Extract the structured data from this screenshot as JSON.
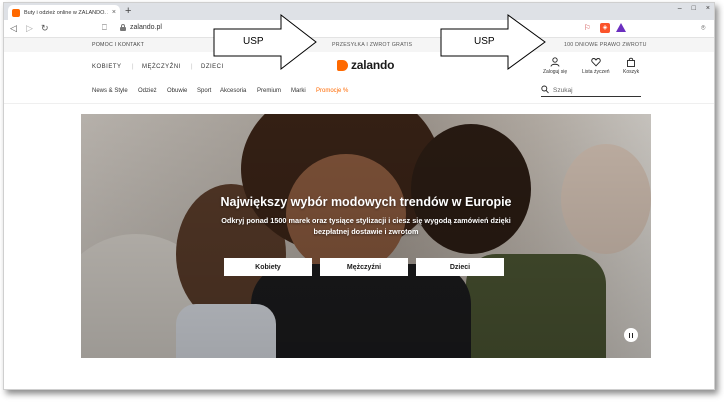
{
  "browser": {
    "tab_title": "Buty i odzież online w ZALANDO. Z",
    "tab_close": "×",
    "new_tab": "+",
    "window_controls": [
      "–",
      "□",
      "×"
    ],
    "url": "zalando.pl",
    "back": "◁",
    "forward": "▷",
    "reload": "↻",
    "bookmark": "⎕",
    "camera": "⌾"
  },
  "topbar": {
    "help": "POMOC I KONTAKT",
    "usp_shipping": "PRZESYŁKA I ZWROT GRATIS",
    "usp_returns": "100 DNIOWE PRAWO ZWROTU"
  },
  "gender_nav": [
    "KOBIETY",
    "MĘŻCZYŹNI",
    "DZIECI"
  ],
  "gender_sep": "|",
  "logo": {
    "text": "zalando",
    "color": "#ff6900"
  },
  "account": {
    "login": "Zaloguj się",
    "wishlist": "Lista życzeń",
    "cart": "Koszyk"
  },
  "categories": [
    "News & Style",
    "Odzież",
    "Obuwie",
    "Sport",
    "Akcesoria",
    "Premium",
    "Marki",
    "Promocje %"
  ],
  "search": {
    "placeholder": "Szukaj"
  },
  "hero": {
    "title": "Największy wybór modowych trendów w Europie",
    "subtitle": "Odkryj ponad 1500 marek oraz tysiące stylizacji i ciesz się wygodą zamówień dzięki bezpłatnej dostawie i zwrotom",
    "buttons": [
      "Kobiety",
      "Mężczyźni",
      "Dzieci"
    ]
  },
  "annotations": {
    "arrow1": "USP",
    "arrow2": "USP"
  }
}
